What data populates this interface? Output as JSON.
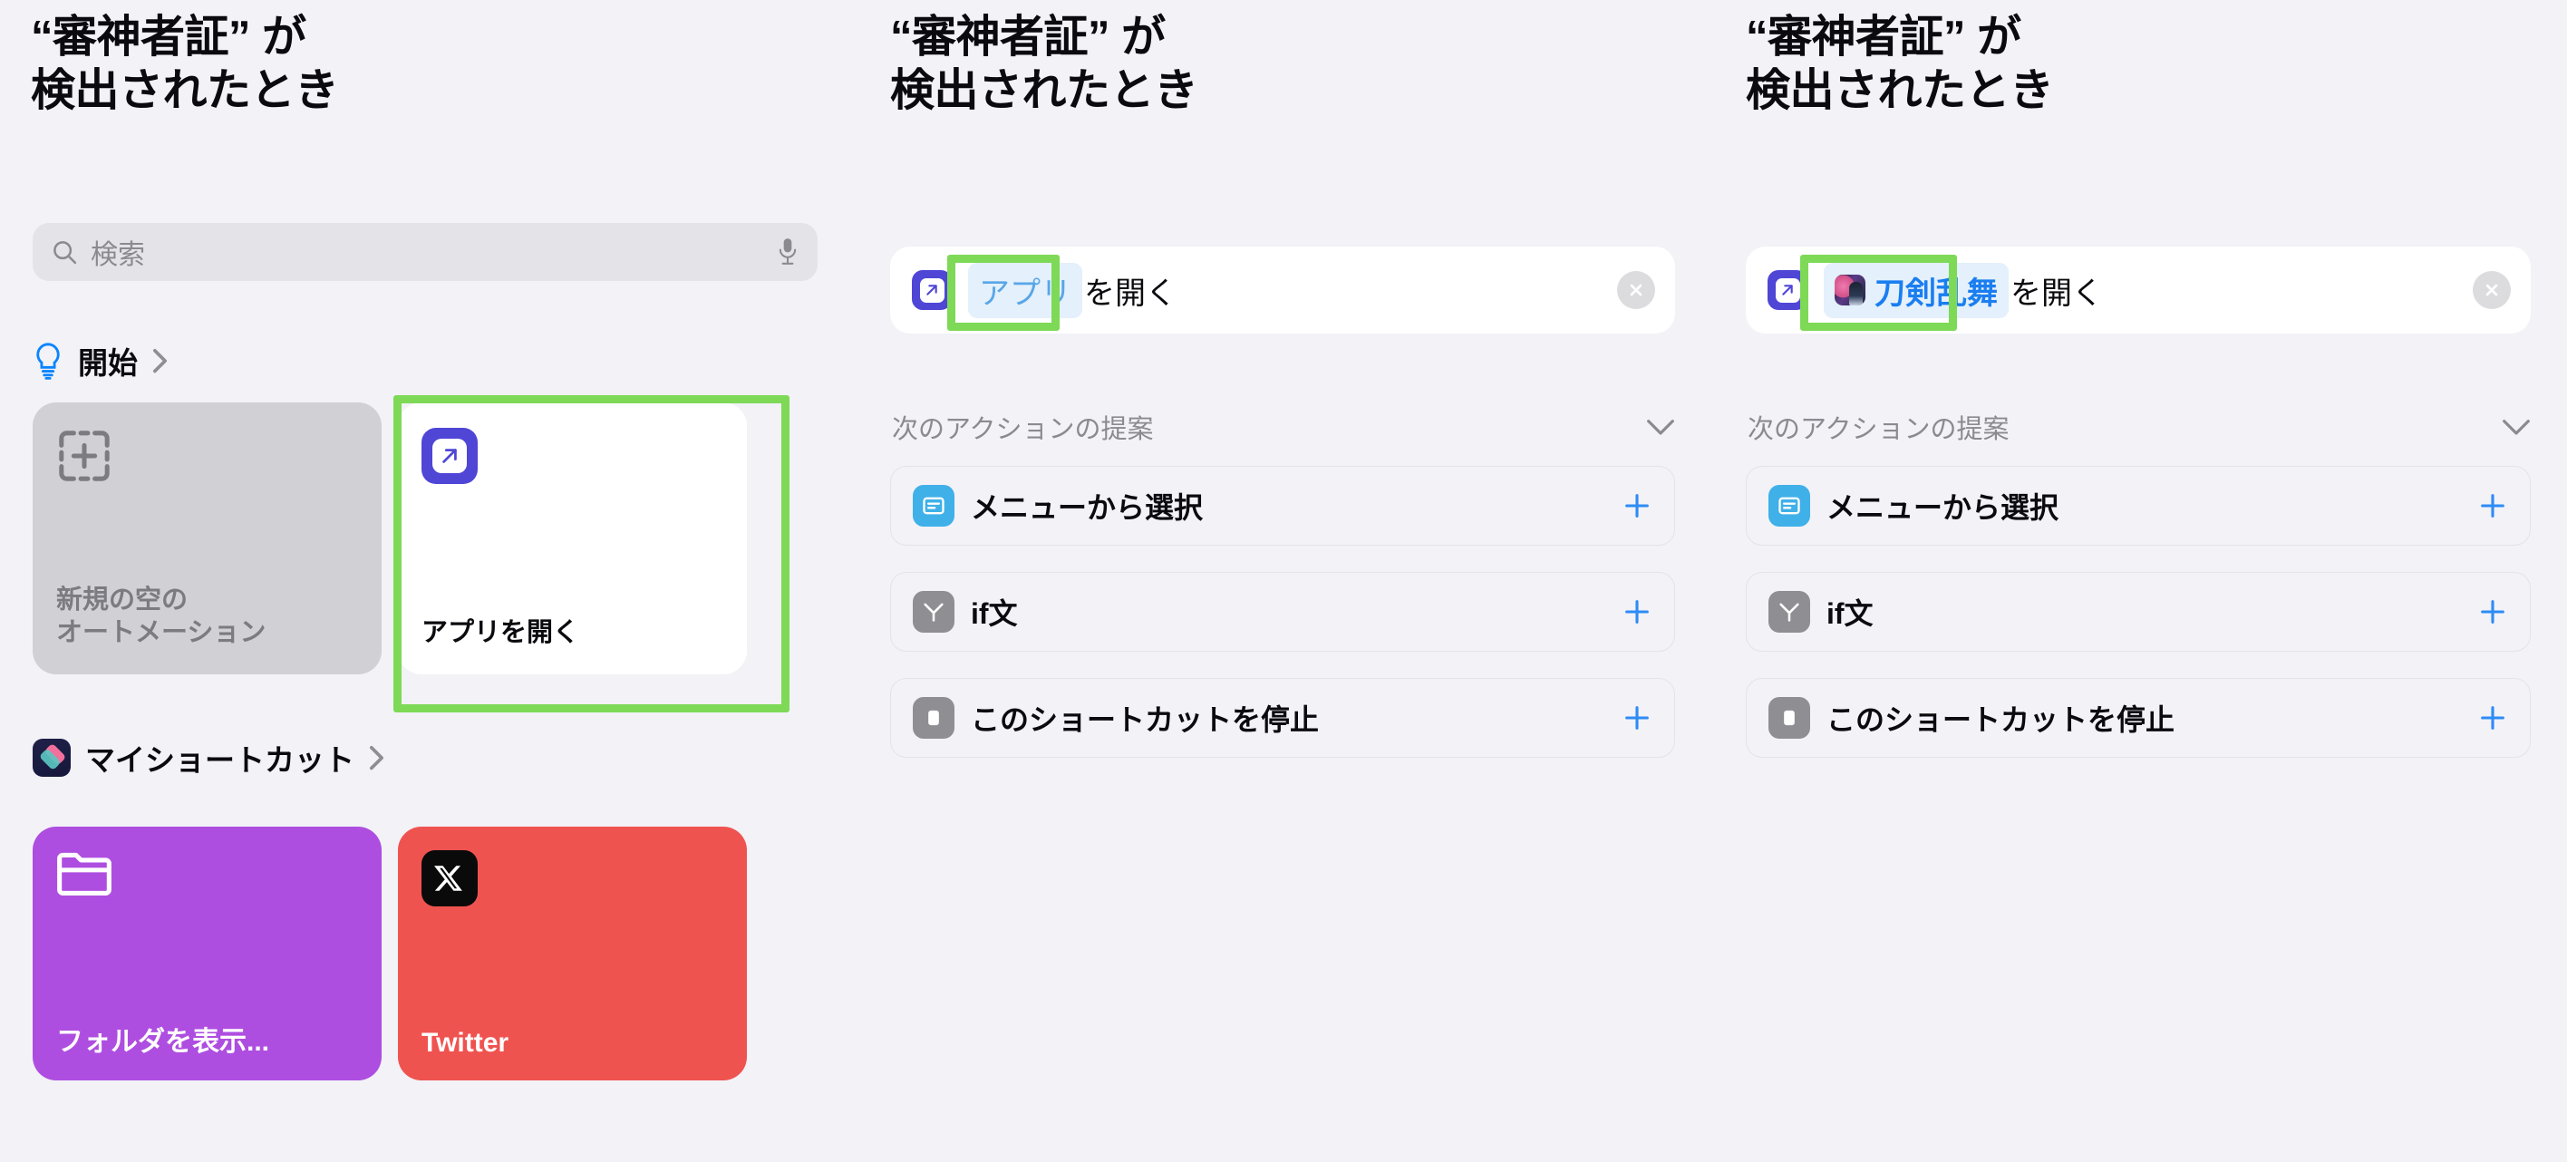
{
  "panels": [
    {
      "id": "panel-shortcut-gallery",
      "title": "“審神者証” が\n検出されたとき",
      "search": {
        "placeholder": "検索",
        "value": "",
        "search_icon": "search-icon",
        "mic_icon": "microphone-icon"
      },
      "sections": [
        {
          "id": "start",
          "icon": "lightbulb-icon",
          "label": "開始",
          "chevron": "chevron-right-icon",
          "cards": [
            {
              "id": "new-blank-automation",
              "label": "新規の空の\nオートメーション",
              "icon": "dashed-plus-box-icon",
              "highlighted": false
            },
            {
              "id": "open-app",
              "label": "アプリを開く",
              "icon": "open-app-icon",
              "highlighted": true
            }
          ]
        },
        {
          "id": "my-shortcuts",
          "icon": "shortcuts-app-icon",
          "label": "マイショートカット",
          "chevron": "chevron-right-icon",
          "tiles": [
            {
              "id": "show-folder",
              "label": "フォルダを表示...",
              "icon": "folder-icon",
              "color": "#ae4ee0"
            },
            {
              "id": "twitter",
              "label": "Twitter",
              "icon": "x-twitter-icon",
              "color": "#ef5350"
            }
          ]
        }
      ]
    },
    {
      "id": "panel-editor-empty-app",
      "title": "“審神者証” が\n検出されたとき",
      "action": {
        "icon": "open-app-icon",
        "token_label": "アプリ",
        "token_filled": false,
        "token_highlighted": true,
        "tail_label": "を開く",
        "close_icon": "close-circle-icon"
      },
      "suggestions": {
        "header": "次のアクションの提案",
        "chevron": "chevron-down-icon",
        "items": [
          {
            "label": "メニューから選択",
            "icon": "menu-select-icon",
            "icon_color": "#3fb0e8",
            "add_icon": "plus-icon"
          },
          {
            "label": "if文",
            "icon": "if-branch-icon",
            "icon_color": "#8e8e93",
            "add_icon": "plus-icon"
          },
          {
            "label": "このショートカットを停止",
            "icon": "stop-icon",
            "icon_color": "#8e8e93",
            "add_icon": "plus-icon"
          }
        ]
      }
    },
    {
      "id": "panel-editor-filled-app",
      "title": "“審神者証” が\n検出されたとき",
      "action": {
        "icon": "open-app-icon",
        "token_label": "刀剣乱舞",
        "token_app_icon": "touken-ranbu-app-icon",
        "token_filled": true,
        "token_highlighted": true,
        "tail_label": "を開く",
        "close_icon": "close-circle-icon"
      },
      "suggestions": {
        "header": "次のアクションの提案",
        "chevron": "chevron-down-icon",
        "items": [
          {
            "label": "メニューから選択",
            "icon": "menu-select-icon",
            "icon_color": "#3fb0e8",
            "add_icon": "plus-icon"
          },
          {
            "label": "if文",
            "icon": "if-branch-icon",
            "icon_color": "#8e8e93",
            "add_icon": "plus-icon"
          },
          {
            "label": "このショートカットを停止",
            "icon": "stop-icon",
            "icon_color": "#8e8e93",
            "add_icon": "plus-icon"
          }
        ]
      }
    }
  ],
  "colors": {
    "background": "#f2f2f7",
    "highlight_green": "#7ed957",
    "accent_blue": "#2d8cf5",
    "action_purple": "#4f46d6",
    "token_blue": "#1a7ef0",
    "token_bg": "#e4f0fb",
    "muted_text": "#8a8a8f"
  }
}
